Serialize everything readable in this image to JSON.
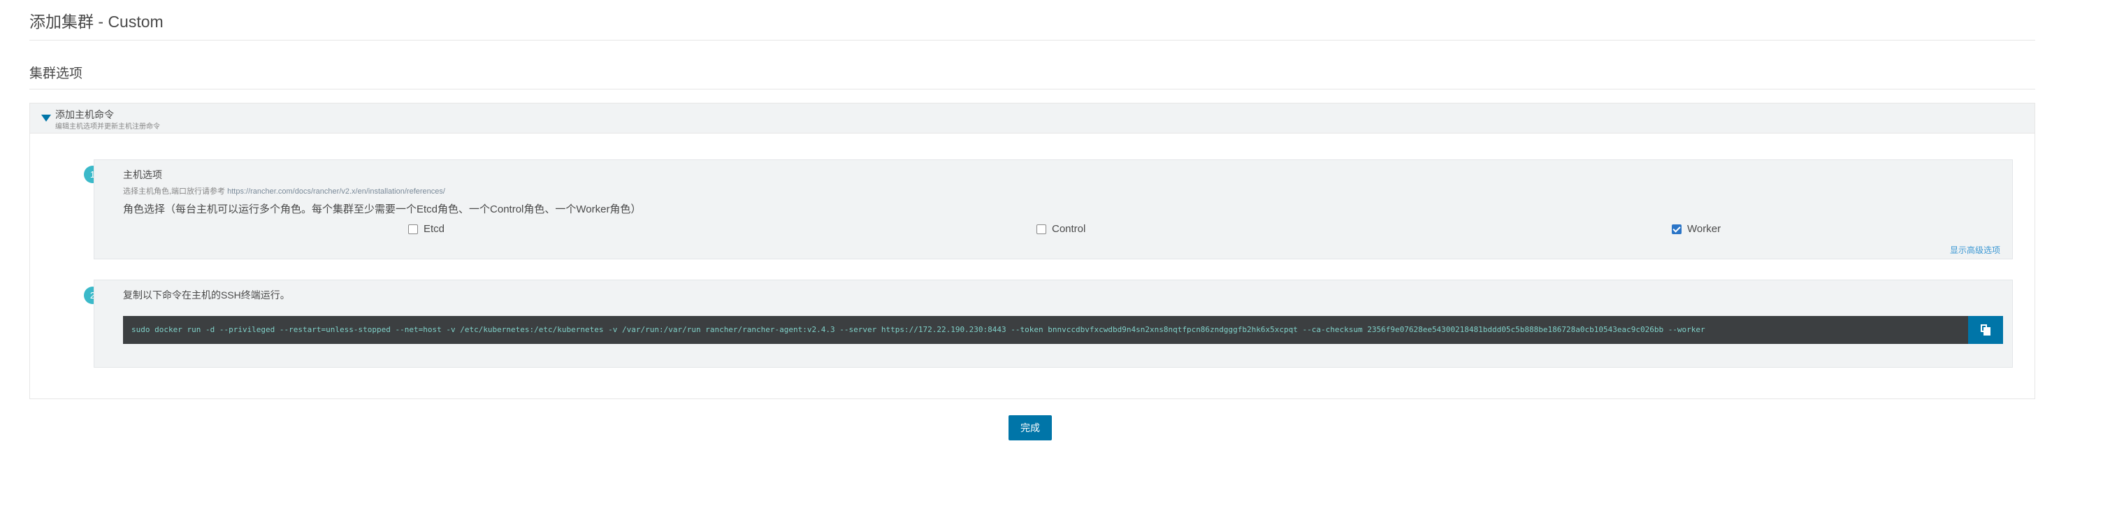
{
  "page": {
    "title": "添加集群 - Custom",
    "section_title": "集群选项"
  },
  "panel": {
    "title": "添加主机命令",
    "subtitle": "编辑主机选项并更新主机注册命令"
  },
  "step1": {
    "number": "1",
    "title": "主机选项",
    "hint_prefix": "选择主机角色,端口放行请参考",
    "hint_link": "https://rancher.com/docs/rancher/v2.x/en/installation/references/",
    "role_text": "角色选择（每台主机可以运行多个角色。每个集群至少需要一个Etcd角色、一个Control角色、一个Worker角色）",
    "roles": [
      {
        "label": "Etcd",
        "checked": false
      },
      {
        "label": "Control",
        "checked": false
      },
      {
        "label": "Worker",
        "checked": true
      }
    ],
    "advanced_link": "显示高级选项"
  },
  "step2": {
    "number": "2",
    "title": "复制以下命令在主机的SSH终端运行。",
    "command": "sudo docker run -d --privileged --restart=unless-stopped --net=host -v /etc/kubernetes:/etc/kubernetes -v /var/run:/var/run rancher/rancher-agent:v2.4.3 --server https://172.22.190.230:8443 --token bnnvccdbvfxcwdbd9n4sn2xns8nqtfpcn86zndgggfb2hk6x5xcpqt --ca-checksum 2356f9e07628ee54300218481bddd05c5b888be186728a0cb10543eac9c026bb --worker"
  },
  "actions": {
    "finish_label": "完成"
  },
  "colors": {
    "accent": "#0075a8",
    "step_badge": "#3bb9c9",
    "command_bg": "#3c3f41",
    "command_text": "#7fd0c8"
  }
}
